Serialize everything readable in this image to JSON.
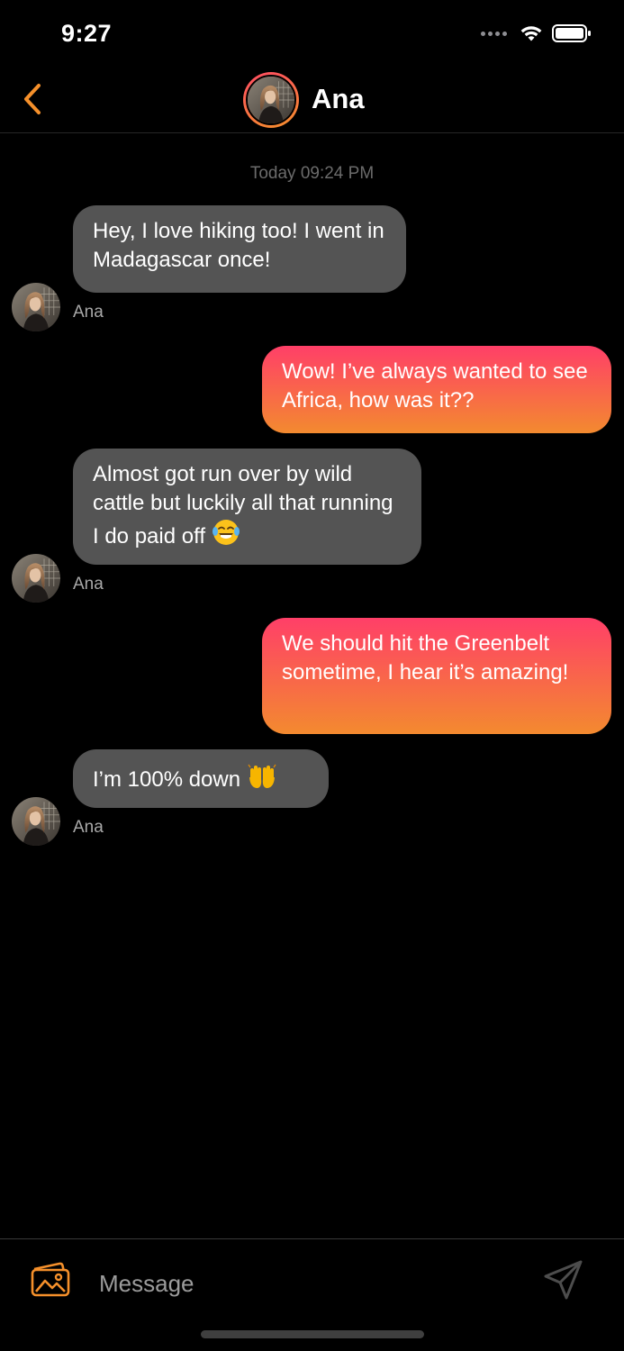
{
  "status_bar": {
    "time": "9:27"
  },
  "header": {
    "contact_name": "Ana",
    "back_icon": "chevron-left-icon"
  },
  "chat": {
    "timestamp": "Today 09:24 PM",
    "messages": [
      {
        "direction": "in",
        "text": "Hey, I love hiking too! I went in Madagascar once!",
        "sender": "Ana"
      },
      {
        "direction": "out",
        "text": "Wow! I’ve always wanted to see Africa, how was it??"
      },
      {
        "direction": "in",
        "text": "Almost got run over by wild cattle but luckily all that running I do paid off",
        "emoji": "😂",
        "sender": "Ana"
      },
      {
        "direction": "out",
        "text": "We should hit the Greenbelt sometime, I hear it’s amazing!"
      },
      {
        "direction": "in",
        "text": "I’m 100% down",
        "emoji": "🙌",
        "sender": "Ana"
      }
    ]
  },
  "composer": {
    "placeholder": "Message",
    "image_icon": "image-gallery-icon",
    "send_icon": "send-icon"
  },
  "colors": {
    "accent_orange": "#f5902b",
    "accent_pink": "#ff3f68",
    "incoming_bubble": "#545454",
    "background": "#000000"
  }
}
